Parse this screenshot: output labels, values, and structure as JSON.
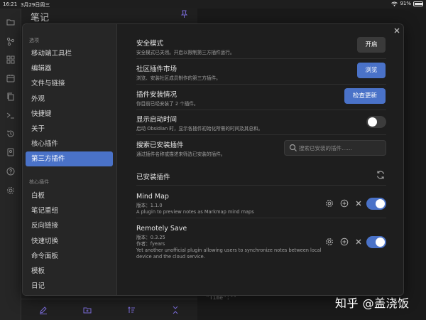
{
  "status": {
    "time": "16:21",
    "date": "3月29日周三",
    "battery": "91%",
    "battery_level": 0.91
  },
  "background": {
    "notes_title": "笔记",
    "code_snippet": "\"Time\":\"\""
  },
  "modal": {
    "sidebar": {
      "options_header": "选项",
      "options": [
        "移动端工具栏",
        "编辑器",
        "文件与链接",
        "外观",
        "快捷键",
        "关于",
        "核心插件",
        "第三方插件"
      ],
      "active_index": 7,
      "core_header": "核心插件",
      "core_plugins": [
        "白板",
        "笔记重组",
        "反向链接",
        "快速切换",
        "命令面板",
        "模板",
        "日记"
      ]
    },
    "safe_mode": {
      "title": "安全模式",
      "desc": "安全模式已关闭。开启以限制第三方插件运行。",
      "button": "开启"
    },
    "community": {
      "title": "社区插件市场",
      "desc": "浏览、安装社区成员制作的第三方插件。",
      "button": "浏览"
    },
    "install_status": {
      "title": "插件安装情况",
      "desc": "你目前已经安装了 2 个插件。",
      "button": "检查更新"
    },
    "startup_time": {
      "title": "显示启动时间",
      "desc": "启动 Obsidian 时，显示各插件初始化所需的时间及其总和。",
      "enabled": false
    },
    "search": {
      "title": "搜索已安装插件",
      "desc": "通过插件名称或描述来筛选已安装的插件。",
      "placeholder": "搜索已安装的插件……"
    },
    "installed_header": "已安装插件",
    "plugins": [
      {
        "name": "Mind Map",
        "version": "版本：1.1.0",
        "desc": "A plugin to preview notes as Markmap mind maps",
        "enabled": true
      },
      {
        "name": "Remotely Save",
        "version": "版本：0.3.25",
        "author": "作者：fyears",
        "desc": "Yet another unofficial plugin allowing users to synchronize notes between local device and the cloud service.",
        "enabled": true
      }
    ]
  },
  "watermark": "知乎 @盖浇饭",
  "colors": {
    "accent": "#4a72c8",
    "background": "#1e1e1e",
    "sidebar": "#262626"
  }
}
